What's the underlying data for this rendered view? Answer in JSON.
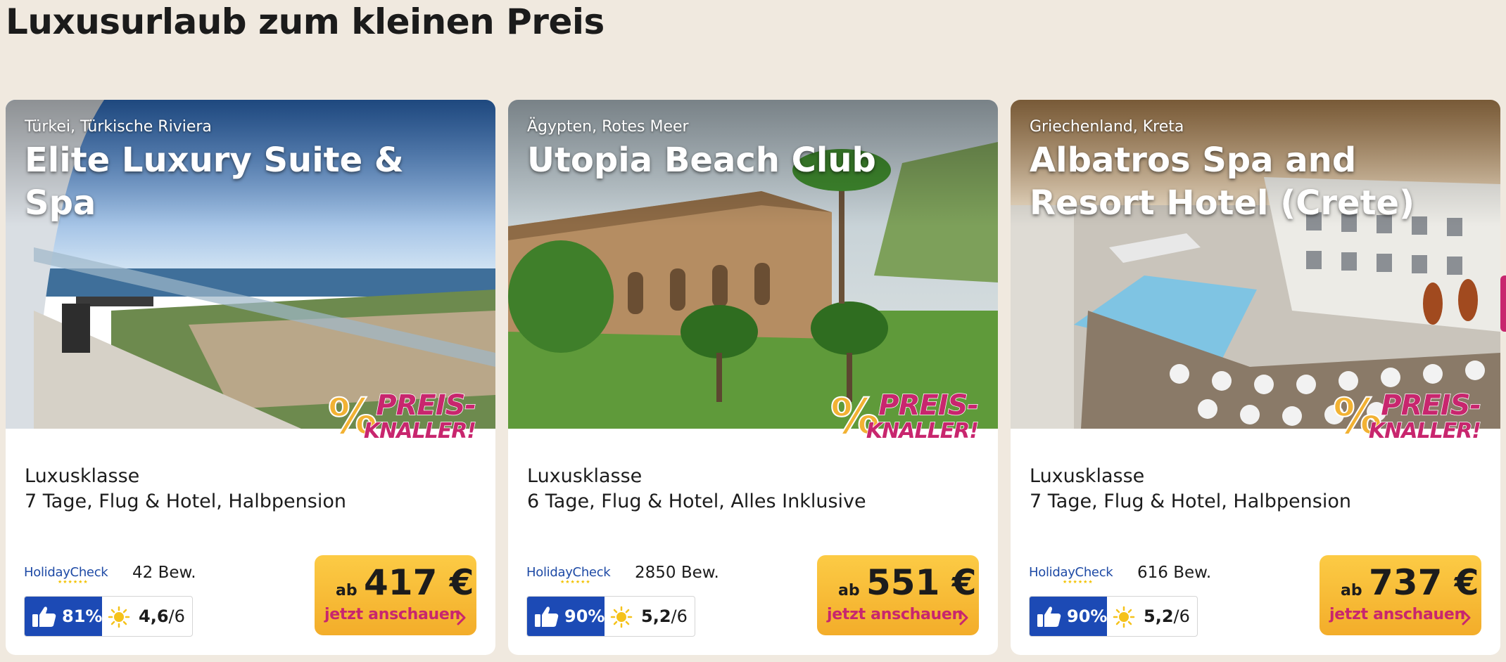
{
  "page": {
    "title": "Luxusurlaub zum kleinen Preis"
  },
  "badge": {
    "line1": "PREIS-",
    "line2": "KNALLER!",
    "symbol": "%"
  },
  "brand": {
    "holidaycheck": "HolidayCheck"
  },
  "colors": {
    "accent": "#c8266e",
    "button": "#f7b733",
    "rating": "#1c4ab5"
  },
  "cards": [
    {
      "location": "Türkei, Türkische Riviera",
      "name": "Elite Luxury Suite & Spa",
      "category": "Luxusklasse",
      "trip": "7 Tage, Flug & Hotel, Halbpension",
      "reviews": "42 Bew.",
      "recommend": "81%",
      "score": "4,6",
      "score_max": "/6",
      "ab": "ab",
      "price": "417 €",
      "cta": "jetzt anschauen"
    },
    {
      "location": "Ägypten, Rotes Meer",
      "name": "Utopia Beach Club",
      "category": "Luxusklasse",
      "trip": "6 Tage, Flug & Hotel, Alles Inklusive",
      "reviews": "2850 Bew.",
      "recommend": "90%",
      "score": "5,2",
      "score_max": "/6",
      "ab": "ab",
      "price": "551 €",
      "cta": "jetzt anschauen"
    },
    {
      "location": "Griechenland, Kreta",
      "name": "Albatros Spa and Resort Hotel (Crete)",
      "category": "Luxusklasse",
      "trip": "7 Tage, Flug & Hotel, Halbpension",
      "reviews": "616 Bew.",
      "recommend": "90%",
      "score": "5,2",
      "score_max": "/6",
      "ab": "ab",
      "price": "737 €",
      "cta": "jetzt anschauen"
    }
  ]
}
